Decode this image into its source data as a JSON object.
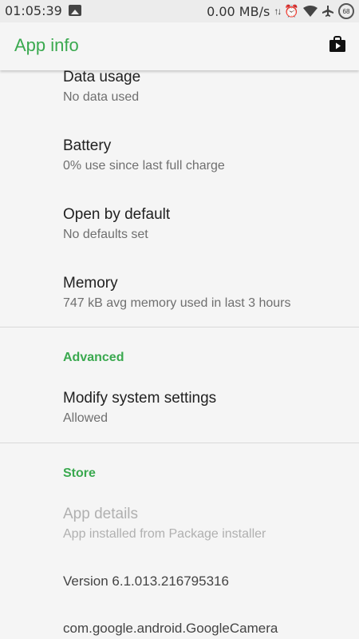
{
  "status_bar": {
    "time": "01:05:39",
    "speed": "0.00 MB/s",
    "battery": "68"
  },
  "app_bar": {
    "title": "App info"
  },
  "items": [
    {
      "title": "Data usage",
      "subtitle": "No data used"
    },
    {
      "title": "Battery",
      "subtitle": "0% use since last full charge"
    },
    {
      "title": "Open by default",
      "subtitle": "No defaults set"
    },
    {
      "title": "Memory",
      "subtitle": "747 kB avg memory used in last 3 hours"
    }
  ],
  "advanced": {
    "header": "Advanced",
    "item": {
      "title": "Modify system settings",
      "subtitle": "Allowed"
    }
  },
  "store": {
    "header": "Store",
    "item": {
      "title": "App details",
      "subtitle": "App installed from Package installer"
    }
  },
  "version": "Version 6.1.013.216795316",
  "package_name": "com.google.android.GoogleCamera",
  "colors": {
    "accent": "#3aa94f",
    "background": "#f5f5f5"
  }
}
